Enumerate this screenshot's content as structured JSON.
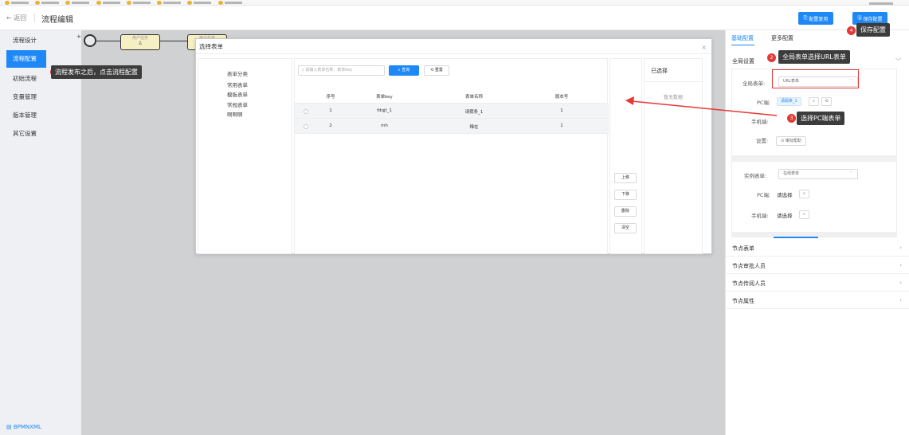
{
  "app": {
    "back_label": "← 返回",
    "page_title": "流程编辑",
    "copy_button": "配置复用",
    "save_button": "保存配置"
  },
  "sidebar": {
    "items": [
      {
        "label": "流程设计"
      },
      {
        "label": "流程配置"
      },
      {
        "label": "初始流程"
      },
      {
        "label": "变量管理"
      },
      {
        "label": "版本管理"
      },
      {
        "label": "其它设置"
      }
    ],
    "footer": "BPMNXML"
  },
  "canvas": {
    "task1": "用户任务",
    "task2": "用户任务"
  },
  "modal": {
    "title": "选择表单",
    "categories": [
      "表单分类",
      "常用表单",
      "模板表单",
      "常规表单",
      "啊啊啊"
    ],
    "search_placeholder": "请输入表单名称、表单key",
    "query_button": "查询",
    "reset_button": "重置",
    "columns": [
      "序号",
      "表单key",
      "表单名称",
      "版本号"
    ],
    "rows": [
      {
        "no": "1",
        "key": "fdqjt_1",
        "name": "请假条_1",
        "version": "1"
      },
      {
        "no": "2",
        "key": "mh",
        "name": "稀在",
        "version": "1"
      }
    ],
    "move_buttons": [
      "上移",
      "下移",
      "删除",
      "清空"
    ],
    "selected_title": "已选择",
    "selected_empty": "暂无数据"
  },
  "right_panel": {
    "tabs": [
      "基础配置",
      "更多配置"
    ],
    "global_settings": "全局设置",
    "global_form_label": "全局表单:",
    "global_form_value": "URL表单",
    "pc_label": "PC端:",
    "pc_tag": "请假条_1",
    "mobile_label": "手机端:",
    "settings_label": "设置:",
    "settings_button": "审批帮助",
    "instance_form_label": "实例表单:",
    "instance_form_value": "在线表单",
    "pc_choose": "请选择",
    "mobile_choose": "请选择",
    "sections": [
      "节点表单",
      "节点审批人员",
      "节点传阅人员",
      "节点属性"
    ]
  },
  "annotations": [
    {
      "num": "1",
      "text": "流程发布之后，点击流程配置"
    },
    {
      "num": "2",
      "text": "全局表单选择URL表单"
    },
    {
      "num": "3",
      "text": "选择PC端表单"
    },
    {
      "num": "4",
      "text": "保存配置"
    }
  ],
  "colors": {
    "accent": "#1e88f7",
    "annotation_red": "#e53935",
    "callout_bg": "#3c3c3c"
  }
}
